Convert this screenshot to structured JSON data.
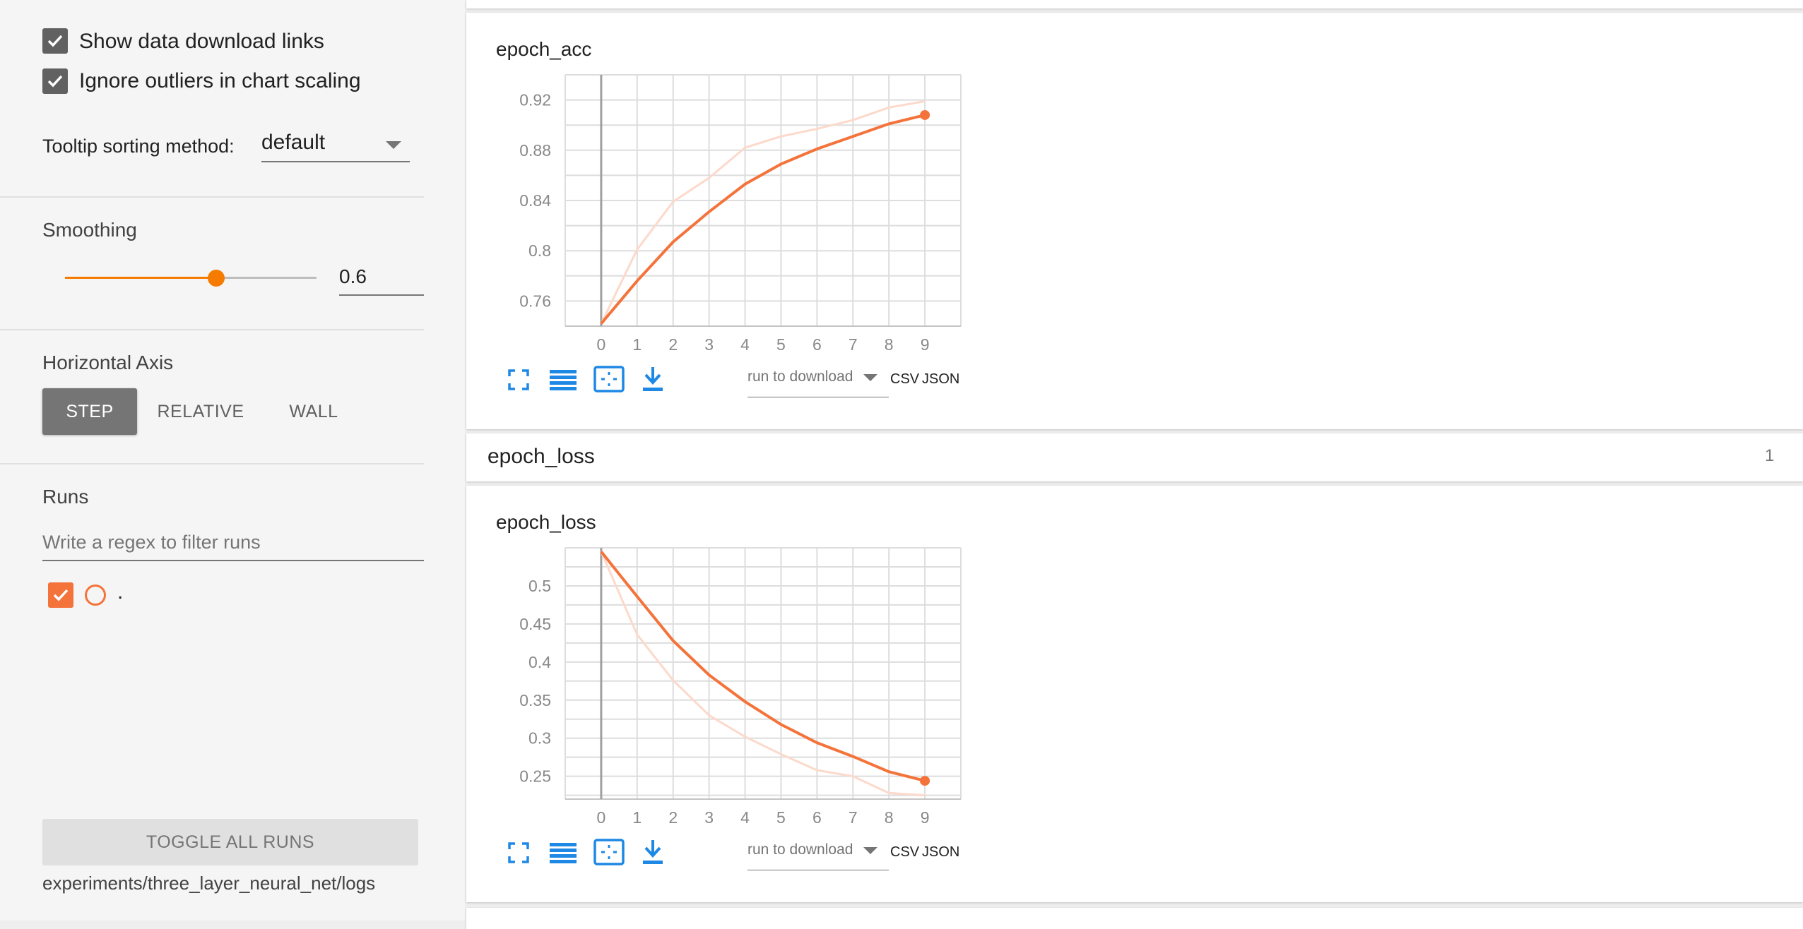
{
  "sidebar": {
    "show_download_links": {
      "label": "Show data download links",
      "checked": true
    },
    "ignore_outliers": {
      "label": "Ignore outliers in chart scaling",
      "checked": true
    },
    "tooltip_sorting": {
      "label": "Tooltip sorting method:",
      "value": "default"
    },
    "smoothing": {
      "label": "Smoothing",
      "value": "0.6",
      "fraction": 0.6
    },
    "horizontal_axis": {
      "label": "Horizontal Axis",
      "options": [
        "STEP",
        "RELATIVE",
        "WALL"
      ],
      "selected": "STEP"
    },
    "runs": {
      "label": "Runs",
      "filter_placeholder": "Write a regex to filter runs",
      "items": [
        {
          "name": ".",
          "checked": true,
          "color": "#f4733b"
        }
      ]
    },
    "toggle_all_runs": "TOGGLE ALL RUNS",
    "logdir": "experiments/three_layer_neural_net/logs"
  },
  "main": {
    "acc_card": {
      "title": "epoch_acc",
      "run_to_download": "run to download",
      "csv": "CSV",
      "json": "JSON"
    },
    "loss_section": {
      "title": "epoch_loss",
      "count": "1"
    },
    "loss_card": {
      "title": "epoch_loss",
      "run_to_download": "run to download",
      "csv": "CSV",
      "json": "JSON"
    }
  },
  "colors": {
    "run_line": "#f4733b",
    "run_raw": "#fcd9cb",
    "accent_orange": "#f57c00",
    "icon_blue": "#1e88e5"
  },
  "icons": [
    "fullscreen-icon",
    "toggle-y-log-icon",
    "fit-domain-icon",
    "download-icon",
    "check-icon",
    "dropdown-arrow-icon"
  ],
  "chart_data": [
    {
      "type": "line",
      "title": "epoch_acc",
      "x": [
        0,
        1,
        2,
        3,
        4,
        5,
        6,
        7,
        8,
        9
      ],
      "xlim": [
        -1,
        10
      ],
      "ylim": [
        0.74,
        0.94
      ],
      "yticks": [
        0.76,
        0.8,
        0.84,
        0.88,
        0.92
      ],
      "ytick_labels": [
        "0.76",
        "0.8",
        "0.84",
        "0.88",
        "0.92"
      ],
      "xtick_labels": [
        "0",
        "1",
        "2",
        "3",
        "4",
        "5",
        "6",
        "7",
        "8",
        "9"
      ],
      "grid": true,
      "series": [
        {
          "smoothed": true,
          "values": [
            0.742,
            0.776,
            0.807,
            0.831,
            0.853,
            0.869,
            0.881,
            0.891,
            0.901,
            0.908
          ]
        },
        {
          "smoothed": false,
          "values": [
            0.742,
            0.801,
            0.839,
            0.858,
            0.882,
            0.891,
            0.897,
            0.904,
            0.914,
            0.919
          ]
        }
      ]
    },
    {
      "type": "line",
      "title": "epoch_loss",
      "x": [
        0,
        1,
        2,
        3,
        4,
        5,
        6,
        7,
        8,
        9
      ],
      "xlim": [
        -1,
        10
      ],
      "ylim": [
        0.22,
        0.55
      ],
      "yticks": [
        0.25,
        0.3,
        0.35,
        0.4,
        0.45,
        0.5
      ],
      "ytick_labels": [
        "0.25",
        "0.3",
        "0.35",
        "0.4",
        "0.45",
        "0.5"
      ],
      "xtick_labels": [
        "0",
        "1",
        "2",
        "3",
        "4",
        "5",
        "6",
        "7",
        "8",
        "9"
      ],
      "grid": true,
      "series": [
        {
          "smoothed": true,
          "values": [
            0.545,
            0.486,
            0.428,
            0.383,
            0.348,
            0.318,
            0.294,
            0.276,
            0.256,
            0.244
          ]
        },
        {
          "smoothed": false,
          "values": [
            0.545,
            0.436,
            0.376,
            0.33,
            0.302,
            0.279,
            0.258,
            0.25,
            0.228,
            0.225
          ]
        }
      ]
    }
  ]
}
